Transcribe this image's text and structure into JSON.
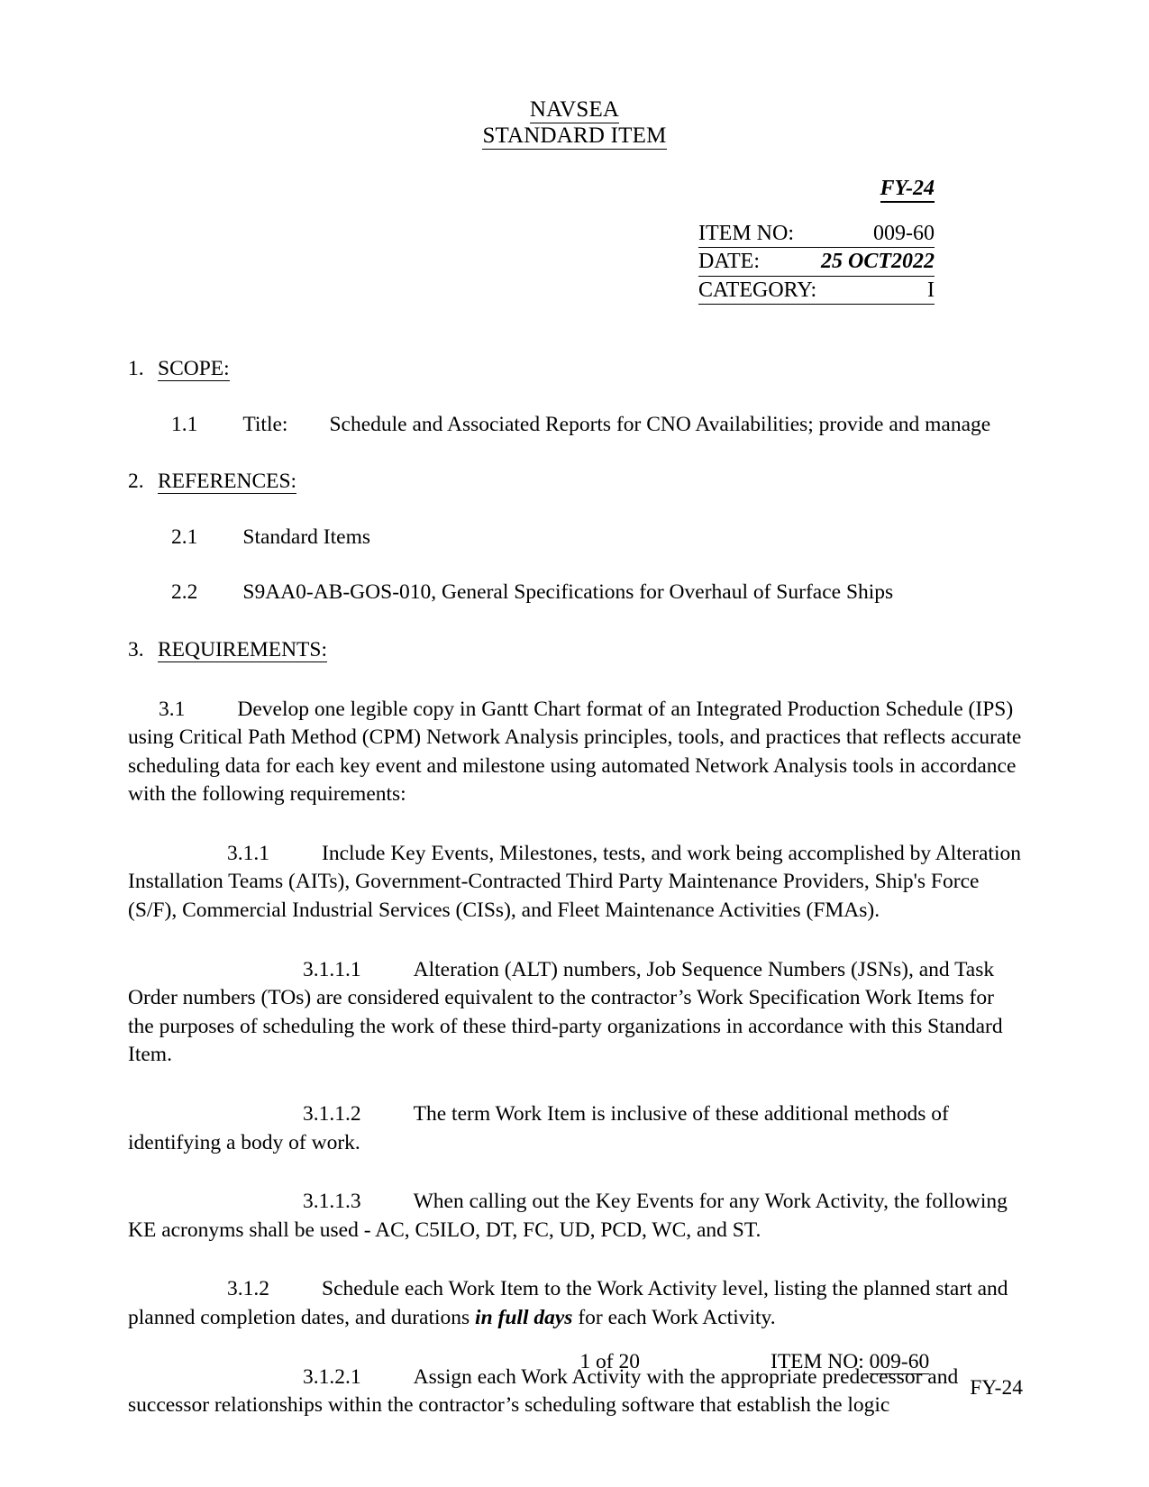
{
  "header": {
    "org_line1": "NAVSEA",
    "org_line2": "STANDARD ITEM",
    "fiscal_year": "FY-24",
    "meta": {
      "item_no_label": "ITEM NO:",
      "item_no_value": "009-60",
      "date_label": "DATE:",
      "date_value": "25 OCT2022",
      "category_label": "CATEGORY:",
      "category_value": "I"
    }
  },
  "sections": {
    "s1": {
      "num": "1.",
      "title": "SCOPE:",
      "p11_num": "1.1",
      "p11_label": "Title:",
      "p11_text": "Schedule and Associated Reports for CNO Availabilities; provide and manage"
    },
    "s2": {
      "num": "2.",
      "title": "REFERENCES:",
      "p21_num": "2.1",
      "p21_text": "Standard Items",
      "p22_num": "2.2",
      "p22_text": "S9AA0-AB-GOS-010, General Specifications for Overhaul of Surface Ships"
    },
    "s3": {
      "num": "3.",
      "title": "REQUIREMENTS:",
      "p31_num": "3.1",
      "p31_text": "Develop one legible copy in Gantt Chart format of an Integrated Production Schedule (IPS) using Critical Path Method (CPM) Network Analysis principles, tools, and practices that reflects accurate scheduling data for each key event and milestone using automated Network Analysis tools in accordance with the following requirements:",
      "p311_num": "3.1.1",
      "p311_text": "Include Key Events, Milestones, tests, and work being accomplished by Alteration Installation Teams (AITs), Government-Contracted Third Party Maintenance Providers, Ship's Force (S/F), Commercial Industrial Services (CISs), and Fleet Maintenance Activities (FMAs).",
      "p3111_num": "3.1.1.1",
      "p3111_text": "Alteration (ALT) numbers, Job Sequence Numbers (JSNs), and Task Order numbers (TOs) are considered equivalent to the contractor’s Work Specification Work Items for the purposes of scheduling the work of these third-party organizations in accordance with this Standard Item.",
      "p3112_num": "3.1.1.2",
      "p3112_text": "The term Work Item is inclusive of these additional methods of identifying a body of work.",
      "p3113_num": "3.1.1.3",
      "p3113_text": "When calling out the Key Events for any Work Activity, the following KE acronyms shall be used - AC, C5ILO, DT, FC, UD, PCD, WC, and ST.",
      "p312_num": "3.1.2",
      "p312_text_a": "Schedule each Work Item to the Work Activity level, listing the planned start and planned completion dates, and durations ",
      "p312_emph": "in full days",
      "p312_text_b": " for each Work Activity.",
      "p3121_num": "3.1.2.1",
      "p3121_text": "Assign each Work Activity with the appropriate predecessor and successor relationships within the contractor’s scheduling software that establish the logic"
    }
  },
  "footer": {
    "page_label": "1 of 20",
    "item_label": "ITEM NO:",
    "item_value": "009-60",
    "fy": "FY-24"
  }
}
